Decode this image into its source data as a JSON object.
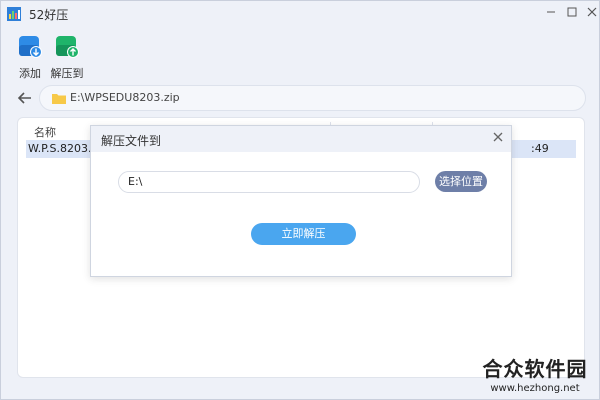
{
  "app": {
    "title": "52好压"
  },
  "toolbar": {
    "add_label": "添加",
    "extract_to_label": "解压到"
  },
  "path": {
    "value": "E:\\WPSEDU8203.zip"
  },
  "list": {
    "columns": [
      "名称"
    ],
    "rows": [
      {
        "name": "W.P.S.8203.30.",
        "time_fragment": ":49"
      }
    ]
  },
  "dialog": {
    "title": "解压文件到",
    "destination_value": "E:\\",
    "choose_location_label": "选择位置",
    "extract_now_label": "立即解压"
  },
  "watermark": {
    "main": "合众软件园",
    "sub": "www.hezhong.net"
  },
  "colors": {
    "accent_blue": "#4aa6ef",
    "choose_button": "#6e7fa8",
    "selected_row": "#dbe5f7"
  }
}
